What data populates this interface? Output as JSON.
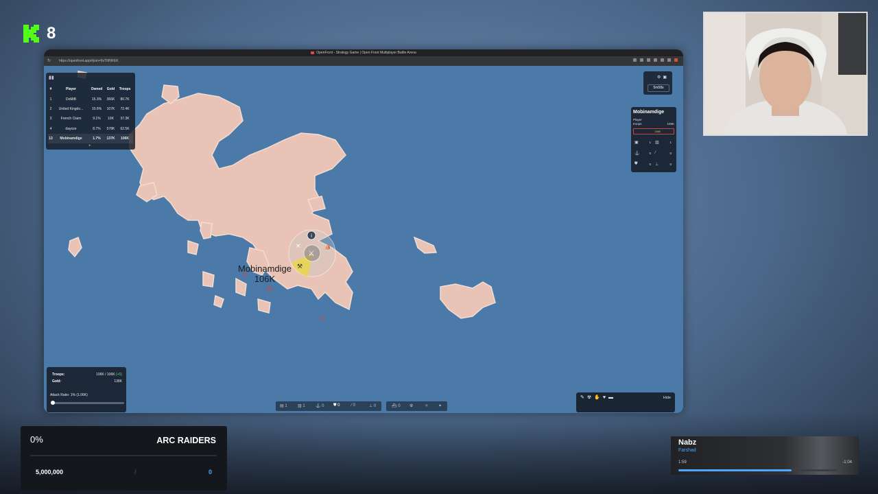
{
  "overlay": {
    "kick_count": "8"
  },
  "browser": {
    "tab_title": "OpenFront - Strategy Game | Open Front Multiplayer Battle Arena",
    "url": "https://openfront.app/#join=9xTMNFEK"
  },
  "leaderboard": {
    "headers": [
      "#",
      "Player",
      "Owned",
      "Gold",
      "Troops"
    ],
    "rows": [
      {
        "rank": "1",
        "player": "DoMiB",
        "owned": "15.3%",
        "gold": "366K",
        "troops": "80.7K"
      },
      {
        "rank": "2",
        "player": "United Kingdo...",
        "owned": "10.6%",
        "gold": "107K",
        "troops": "72.4K"
      },
      {
        "rank": "3",
        "player": "French Claim",
        "owned": "9.1%",
        "gold": "10K",
        "troops": "37.3K"
      },
      {
        "rank": "4",
        "player": "dayoze",
        "owned": "8.7%",
        "gold": "578K",
        "troops": "62.5K"
      },
      {
        "rank": "13",
        "player": "Mobinamdige",
        "owned": "1.7%",
        "gold": "137K",
        "troops": "106K"
      }
    ],
    "expand": "+"
  },
  "timer": {
    "value": "5m58s"
  },
  "player_info": {
    "name": "Mobinamdige",
    "type": "Player",
    "troops_label": "troops",
    "troops_value": "106K",
    "gold": "138K",
    "stats": [
      {
        "icon": "city",
        "value": "1"
      },
      {
        "icon": "factory",
        "value": "1"
      },
      {
        "icon": "port",
        "value": "0"
      },
      {
        "icon": "missile",
        "value": "0"
      },
      {
        "icon": "defense",
        "value": "0"
      },
      {
        "icon": "sam",
        "value": "0"
      }
    ]
  },
  "map_label": {
    "name": "Mobinamdige",
    "troops": "106K"
  },
  "troops_panel": {
    "troops_label": "Troops:",
    "troops_value": "106K / 106K",
    "troops_inc": "(+5)",
    "gold_label": "Gold:",
    "gold_value": "138K",
    "attack_ratio": "Attack Ratio: 1% (1.06K)",
    "attack_ratio_value": 0.01
  },
  "build_bar": {
    "items": [
      {
        "icon": "city",
        "count": "1"
      },
      {
        "icon": "factory",
        "count": "1"
      },
      {
        "icon": "port",
        "count": "0"
      },
      {
        "icon": "defense",
        "count": "0"
      },
      {
        "icon": "missile",
        "count": "0"
      },
      {
        "icon": "sam",
        "count": "0"
      }
    ],
    "items2": [
      {
        "icon": "warship",
        "count": "0"
      }
    ]
  },
  "chat_panel": {
    "hide_label": "Hide"
  },
  "arc_panel": {
    "percent": "0%",
    "name": "ARC RAIDERS",
    "goal": "5,000,000",
    "slash": "/",
    "current": "0",
    "progress": 0
  },
  "music": {
    "artist": "Nabz",
    "track": "Farshad",
    "elapsed": "1:59",
    "remaining": "-1:04",
    "progress": 0.71
  },
  "colors": {
    "ocean": "#4b7aa8",
    "land": "#e9c4b6",
    "accent_blue": "#4aa8ff",
    "kick_green": "#53fc18"
  }
}
